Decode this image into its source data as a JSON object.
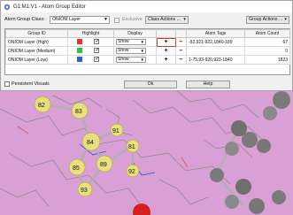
{
  "window": {
    "title": "G1:M1:V1 - Atom Group Editor"
  },
  "toolbar": {
    "atom_group_class_label": "Atom Group Class:",
    "atom_group_class_value": "ONIOM Layer",
    "exclusive_label": "Exclusive",
    "class_actions_label": "Class Actions ...",
    "group_actions_label": "Group Actions ..."
  },
  "table": {
    "headers": [
      "Group ID",
      "Highlight",
      "Display",
      "",
      "",
      "Atom Tags",
      "Atom Count"
    ],
    "rows": [
      {
        "group_id": "ONIOM Layer (High)",
        "color": "#e8322a",
        "highlight": true,
        "display": "Show",
        "tags": "-92,921-922,1840-189",
        "count": "67"
      },
      {
        "group_id": "ONIOM Layer (Medium)",
        "color": "#3fbf3f",
        "highlight": true,
        "display": "Show",
        "tags": "",
        "count": "0"
      },
      {
        "group_id": "ONIOM Layer (Low)",
        "color": "#2f5fd6",
        "highlight": true,
        "display": "Show",
        "tags": "1-75,93-920,923-1840",
        "count": "1823"
      }
    ],
    "plus_symbol": "+",
    "minus_symbol": "–"
  },
  "bottom": {
    "persistent_visuals_label": "Persistent Visuals",
    "ok_label": "Ok",
    "help_label": "Help"
  },
  "viewport": {
    "atom_labels": [
      "82",
      "83",
      "84",
      "91",
      "81",
      "85",
      "89",
      "92",
      "93"
    ]
  }
}
